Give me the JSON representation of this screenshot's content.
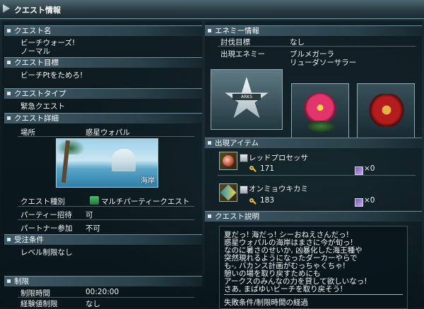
{
  "window": {
    "title": "クエスト情報"
  },
  "left": {
    "quest_name": {
      "header": "クエスト名",
      "line1": "ビーチウォーズ!",
      "line2": "ノーマル"
    },
    "objective": {
      "header": "クエスト目標",
      "value": "ビーチPtをためろ!"
    },
    "quest_type": {
      "header": "クエストタイプ",
      "value": "緊急クエスト"
    },
    "details": {
      "header": "クエスト詳細",
      "location_label": "場所",
      "location_value": "惑星ウォパル",
      "area_caption": "海岸",
      "rows": [
        {
          "label": "クエスト種別",
          "value": "マルチパーティークエスト"
        },
        {
          "label": "パーティー招待",
          "value": "可"
        },
        {
          "label": "パートナー参加",
          "value": "不可"
        }
      ]
    },
    "conditions": {
      "header": "受注条件",
      "value": "レベル制限なし"
    },
    "limits": {
      "header": "制限",
      "rows": [
        {
          "label": "制限時間",
          "value": "00:20:00"
        },
        {
          "label": "経験値制限",
          "value": "なし"
        }
      ]
    }
  },
  "right": {
    "enemy": {
      "header": "エネミー情報",
      "target_label": "討伐目標",
      "target_value": "なし",
      "appear_label": "出現エネミー",
      "appear_line1": "ブルメガーラ",
      "appear_line2": "リューダソーサラー",
      "emblem_text": "ARKS"
    },
    "items": {
      "header": "出現アイテム",
      "list": [
        {
          "name": "レッドプロセッサ",
          "count": "171",
          "owned": "×0",
          "icon": "red-processor-icon"
        },
        {
          "name": "オンミョウキカミ",
          "count": "183",
          "owned": "×0",
          "icon": "onmyou-kikami-icon"
        }
      ]
    },
    "description": {
      "header": "クエスト説明",
      "lines": [
        "夏だっ! 海だっ! シーおねえさんだっ!",
        "惑星ウォパルの海岸はまさに今が旬っ!",
        "なのに暑さのせいか, 凶暴化した海王種や",
        "突然現れるようになったダーカーやらで",
        "も-, バカンス計画がむっちゃくちゃ!",
        "憩いの場を取り戻すためにも",
        "アークスのみんなの力を貸して欲しいなっ!",
        "さあ, まばゆいビーチを取り戻そう!"
      ],
      "fail_condition": "失敗条件/制限時間の経過"
    }
  },
  "colors": {
    "accent": "#3f5a66",
    "title_bar": "#2b3d45"
  }
}
